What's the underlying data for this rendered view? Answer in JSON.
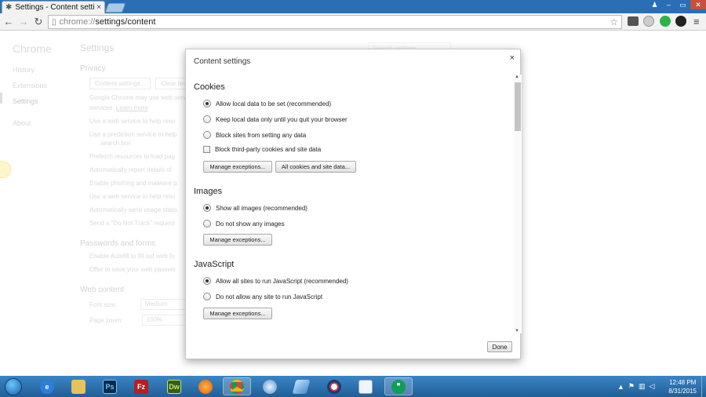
{
  "browser": {
    "tab_title": "Settings - Content setting",
    "tab_close": "×",
    "url_scheme": "chrome://",
    "url_path": "settings/content",
    "window_controls": [
      "–",
      "▭",
      "✕"
    ]
  },
  "background_page": {
    "nav_title": "Chrome",
    "nav_items": [
      "History",
      "Extensions",
      "Settings",
      "About"
    ],
    "page_title": "Settings",
    "search_placeholder": "Search settings",
    "privacy": {
      "heading": "Privacy",
      "btn_content": "Content settings...",
      "btn_clear": "Clear brow",
      "desc1": "Google Chrome may use web servic",
      "desc2": "services.",
      "learn_more": "Learn more",
      "rows": [
        "Use a web service to help reso",
        "Use a prediction service to help",
        "search box",
        "Prefetch resources to load pag",
        "Automatically report details of",
        "Enable phishing and malware p",
        "Use a web service to help reso",
        "Automatically send usage statis",
        "Send a \"Do Not Track\" request"
      ]
    },
    "passwords": {
      "heading": "Passwords and forms",
      "rows": [
        "Enable Autofill to fill out web fo",
        "Offer to save your web passwo"
      ]
    },
    "web_content": {
      "heading": "Web content",
      "font_size_label": "Font size:",
      "font_size_value": "Medium",
      "zoom_label": "Page zoom:",
      "zoom_value": "100%"
    }
  },
  "dialog": {
    "title": "Content settings",
    "close": "×",
    "done_label": "Done",
    "cookies": {
      "heading": "Cookies",
      "options": [
        "Allow local data to be set (recommended)",
        "Keep local data only until you quit your browser",
        "Block sites from setting any data"
      ],
      "selected_index": 0,
      "checkbox_label": "Block third-party cookies and site data",
      "checkbox_checked": false,
      "btn_manage": "Manage exceptions...",
      "btn_all_cookies": "All cookies and site data..."
    },
    "images": {
      "heading": "Images",
      "options": [
        "Show all images (recommended)",
        "Do not show any images"
      ],
      "selected_index": 0,
      "btn_manage": "Manage exceptions..."
    },
    "javascript": {
      "heading": "JavaScript",
      "options": [
        "Allow all sites to run JavaScript (recommended)",
        "Do not allow any site to run JavaScript"
      ],
      "selected_index": 0,
      "btn_manage": "Manage exceptions..."
    }
  },
  "taskbar": {
    "apps": [
      "Internet Explorer",
      "Windows Explorer",
      "Photoshop",
      "FileZilla",
      "Dreamweaver",
      "Firefox",
      "Chrome",
      "Safari",
      "Windows Live Writer",
      "Google Talk",
      "Notepad",
      "Hangouts"
    ],
    "app_labels": {
      "ps": "Ps",
      "dw": "Dw",
      "fz": "Fz"
    },
    "clock_time": "12:48 PM",
    "clock_date": "8/31/2015"
  }
}
